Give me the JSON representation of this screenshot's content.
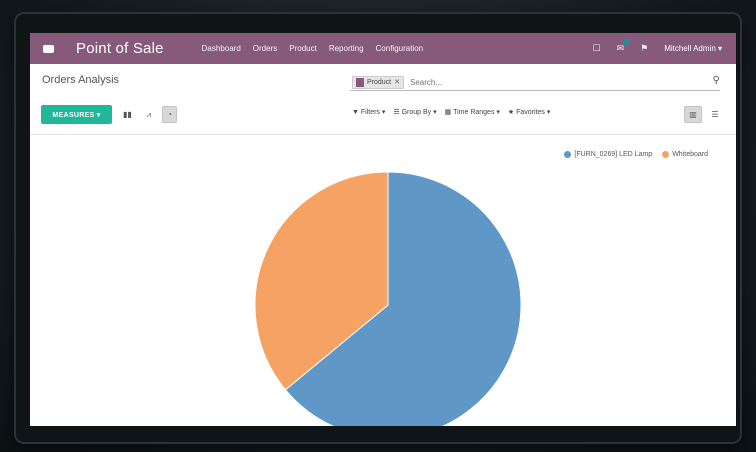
{
  "navbar": {
    "brand": "Point of Sale",
    "menu": [
      "Dashboard",
      "Orders",
      "Product",
      "Reporting",
      "Configuration"
    ],
    "user": "Mitchell Admin ▾",
    "bg_color": "#875a7b"
  },
  "control_panel": {
    "title": "Orders Analysis",
    "search": {
      "facet_label": "Product",
      "placeholder": "Search..."
    },
    "measures_label": "MEASURES ▾",
    "filters": [
      "▼ Filters ▾",
      "☰ Group By ▾",
      "▦ Time Ranges ▾",
      "★ Favorites ▾"
    ],
    "accent_color": "#21b799"
  },
  "chart_data": {
    "type": "pie",
    "series": [
      {
        "name": "[FURN_0269] LED Lamp",
        "value": 64,
        "color": "#5f97c6"
      },
      {
        "name": "Whiteboard",
        "value": 36,
        "color": "#f6a263"
      }
    ],
    "legend_position": "top-right"
  }
}
